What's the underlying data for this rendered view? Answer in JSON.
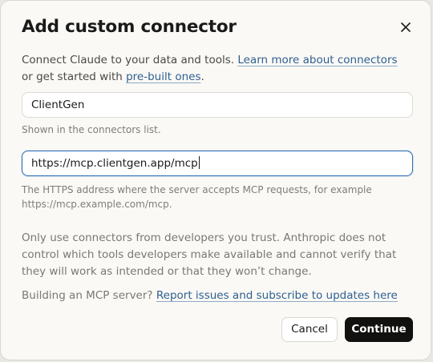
{
  "dialog": {
    "title": "Add custom connector",
    "close_icon": "close-icon",
    "intro": {
      "text_1": "Connect Claude to your data and tools. ",
      "link_learn": "Learn more about connectors",
      "text_2": " or get started with ",
      "link_prebuilt": "pre-built ones",
      "text_3": "."
    },
    "name_field": {
      "value": "ClientGen",
      "hint": "Shown in the connectors list."
    },
    "url_field": {
      "value": "https://mcp.clientgen.app/mcp",
      "hint": "The HTTPS address where the server accepts MCP requests, for example https://mcp.example.com/mcp."
    },
    "notice": "Only use connectors from developers you trust. Anthropic does not control which tools developers make available and cannot verify that they will work as intended or that they won’t change.",
    "building": {
      "text": "Building an MCP server? ",
      "link": "Report issues and subscribe to updates here"
    },
    "buttons": {
      "cancel": "Cancel",
      "continue": "Continue"
    }
  },
  "colors": {
    "link": "#2f5f8f",
    "focus_border": "#2e6fb5",
    "primary_button": "#111110"
  }
}
